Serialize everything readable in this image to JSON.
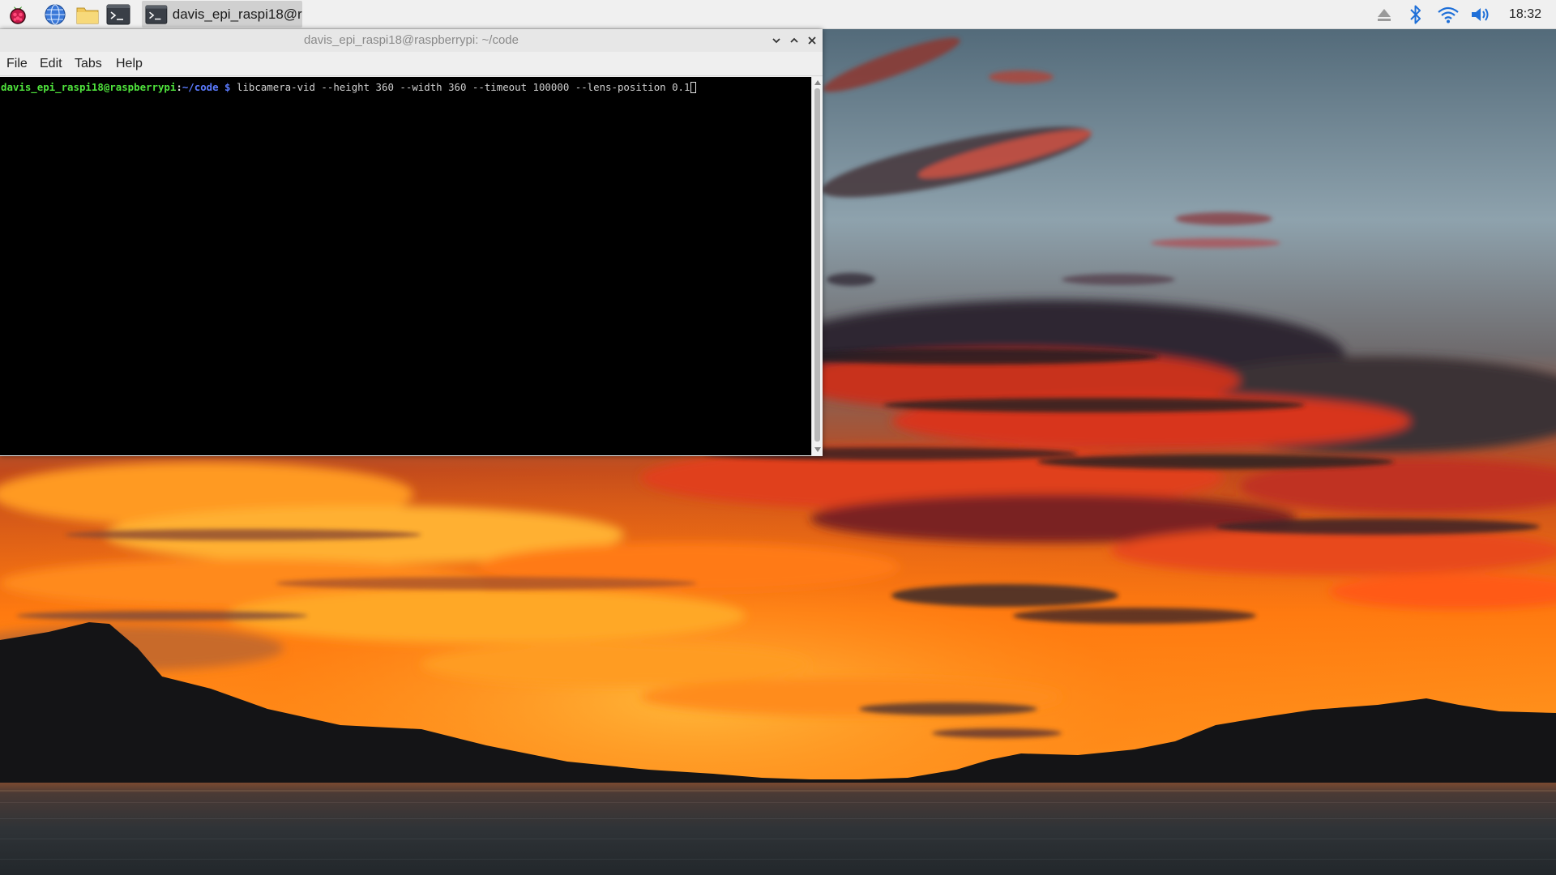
{
  "taskbar": {
    "launchers": [
      {
        "name": "raspberry-menu",
        "icon": "raspberry-pi-logo-icon"
      },
      {
        "name": "web-browser",
        "icon": "globe-icon"
      },
      {
        "name": "file-manager",
        "icon": "folder-icon"
      },
      {
        "name": "terminal",
        "icon": "terminal-icon"
      }
    ],
    "task": {
      "label": "davis_epi_raspi18@r...",
      "icon": "terminal-icon"
    },
    "tray": {
      "icons": [
        "eject-icon",
        "bluetooth-icon",
        "wifi-icon",
        "volume-icon"
      ],
      "clock": "18:32"
    }
  },
  "terminal_window": {
    "title": "davis_epi_raspi18@raspberrypi: ~/code",
    "controls": [
      "minimize-icon",
      "maximize-icon",
      "close-icon"
    ],
    "menu": [
      "File",
      "Edit",
      "Tabs",
      "Help"
    ],
    "prompt": {
      "user_host": "davis_epi_raspi18@raspberrypi",
      "separator": ":",
      "path": "~/code",
      "symbol": "$",
      "command": "libcamera-vid --height 360 --width 360 --timeout 100000 --lens-position 0.1"
    }
  },
  "wallpaper": {
    "subject": "sunset-over-lake-with-mountains",
    "colors": {
      "sky_top": "#5c7585",
      "sky_mid": "#8fa3ad",
      "cloud_red": "#e0321b",
      "cloud_orange": "#ff8a1e",
      "cloud_dark": "#3a2a2c",
      "mountain": "#141416",
      "water": "#30353a"
    }
  },
  "colors": {
    "taskbar_bg": "#f0f0f0",
    "task_active_bg": "#d0d0d0",
    "terminal_bg": "#000000",
    "prompt_user": "#4fe33c",
    "prompt_path": "#5b7bff",
    "command_text": "#cfcfcf"
  }
}
